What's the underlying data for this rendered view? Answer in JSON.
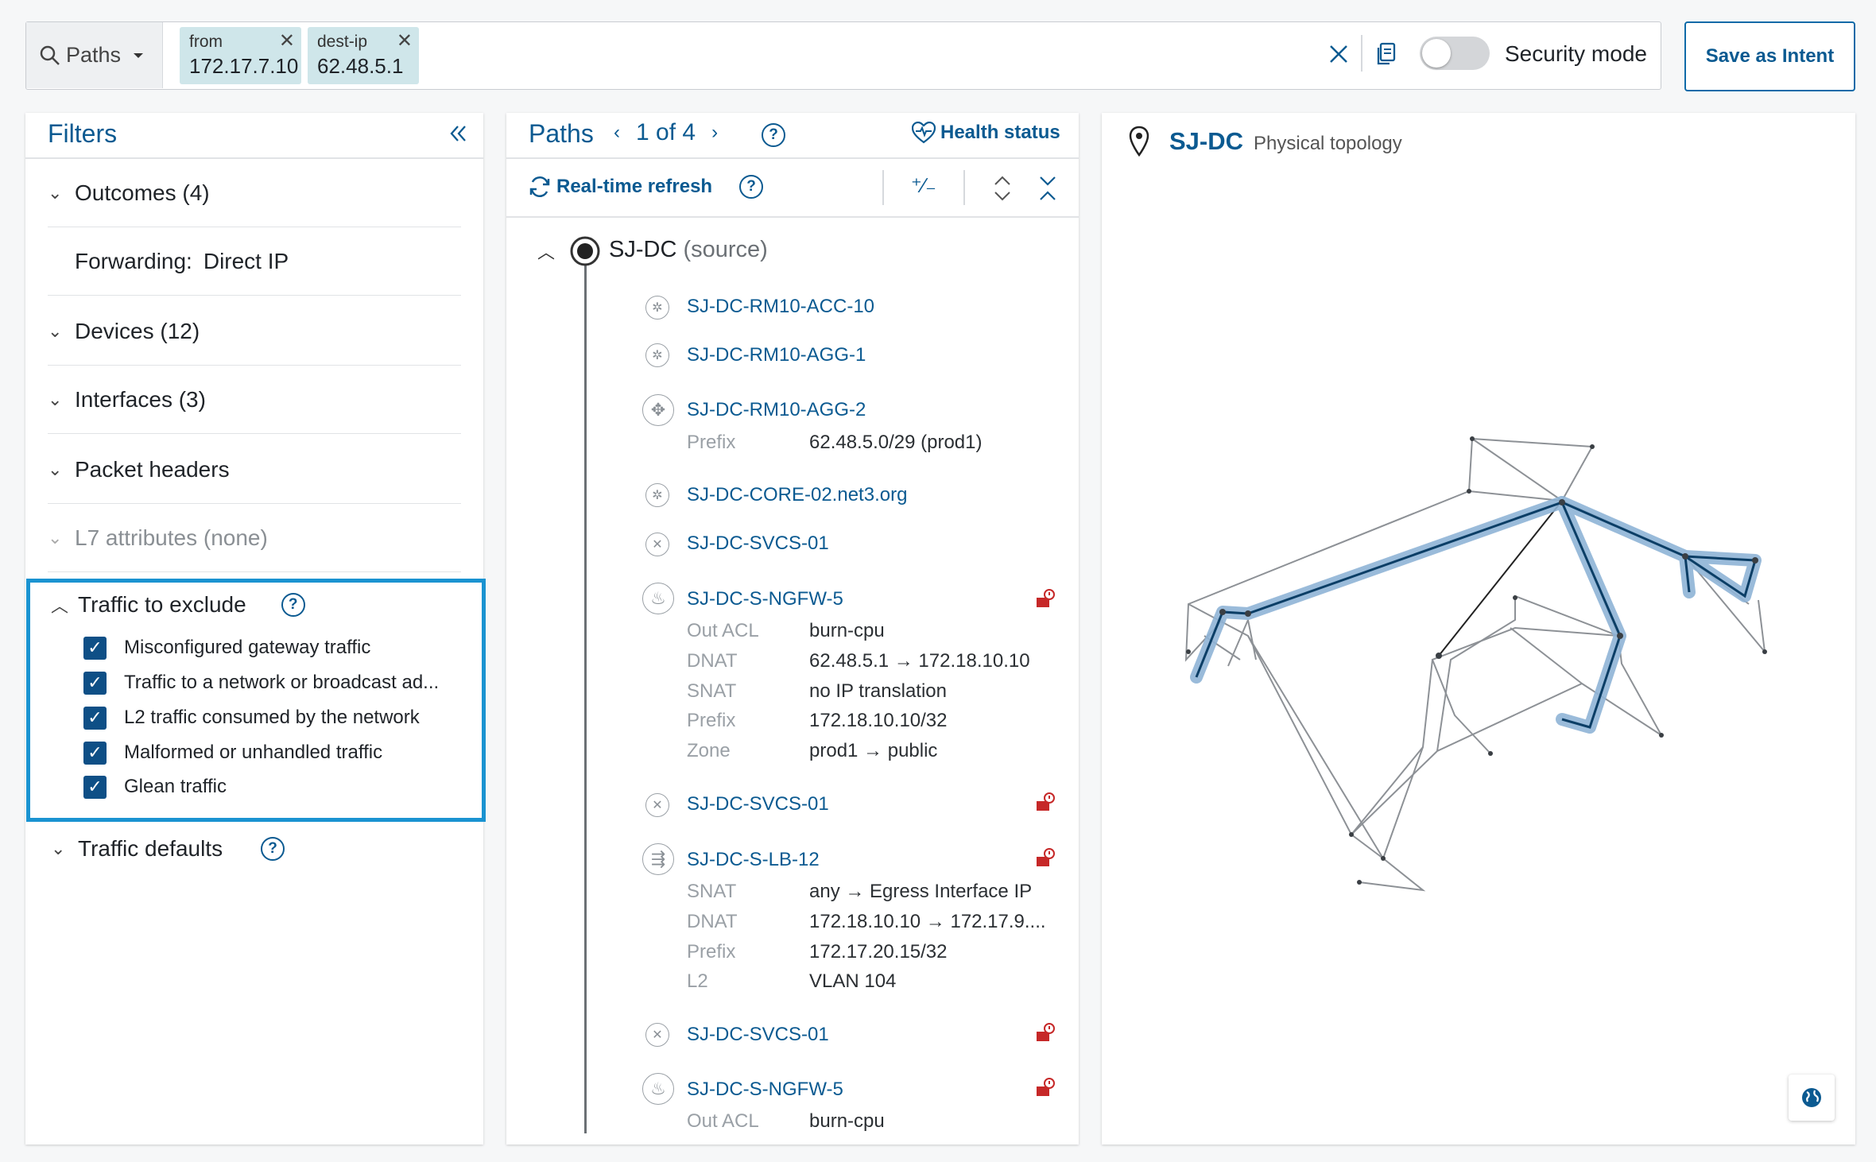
{
  "search": {
    "mode": "Paths",
    "chips": [
      {
        "key": "from",
        "value": "172.17.7.10"
      },
      {
        "key": "dest-ip",
        "value": "62.48.5.1"
      }
    ],
    "security_mode_label": "Security mode",
    "save_label": "Save as Intent"
  },
  "filters": {
    "title": "Filters",
    "sections": {
      "outcomes": "Outcomes (4)",
      "forwarding_key": "Forwarding:",
      "forwarding_value": "Direct IP",
      "devices": "Devices (12)",
      "interfaces": "Interfaces (3)",
      "packet_headers": "Packet headers",
      "l7": "L7 attributes (none)",
      "traffic_exclude": "Traffic to exclude",
      "traffic_defaults": "Traffic defaults"
    },
    "exclude_items": [
      "Misconfigured gateway traffic",
      "Traffic to a network or broadcast ad...",
      "L2 traffic consumed by the network",
      "Malformed or unhandled traffic",
      "Glean traffic"
    ]
  },
  "paths": {
    "title": "Paths",
    "pager": "1 of 4",
    "health_label": "Health status",
    "refresh_label": "Real-time refresh",
    "source_name": "SJ-DC",
    "source_suffix": "(source)",
    "hops": [
      {
        "name": "SJ-DC-RM10-ACC-10"
      },
      {
        "name": "SJ-DC-RM10-AGG-1"
      },
      {
        "name": "SJ-DC-RM10-AGG-2",
        "details": [
          [
            "Prefix",
            "62.48.5.0/29 (prod1)"
          ]
        ]
      },
      {
        "name": "SJ-DC-CORE-02.net3.org"
      },
      {
        "name": "SJ-DC-SVCS-01"
      },
      {
        "name": "SJ-DC-S-NGFW-5",
        "details": [
          [
            "Out ACL",
            "burn-cpu"
          ],
          [
            "DNAT",
            "62.48.5.1 → 172.18.10.10"
          ],
          [
            "SNAT",
            "no IP translation"
          ],
          [
            "Prefix",
            "172.18.10.10/32"
          ],
          [
            "Zone",
            "prod1 → public"
          ]
        ]
      },
      {
        "name": "SJ-DC-SVCS-01"
      },
      {
        "name": "SJ-DC-S-LB-12",
        "details": [
          [
            "SNAT",
            "any → Egress Interface IP"
          ],
          [
            "DNAT",
            "172.18.10.10 → 172.17.9...."
          ],
          [
            "Prefix",
            "172.17.20.15/32"
          ],
          [
            "L2",
            "VLAN 104"
          ]
        ]
      },
      {
        "name": "SJ-DC-SVCS-01"
      },
      {
        "name": "SJ-DC-S-NGFW-5",
        "details": [
          [
            "Out ACL",
            "burn-cpu"
          ]
        ]
      }
    ]
  },
  "topology": {
    "site": "SJ-DC",
    "subtitle": "Physical topology"
  },
  "icons": {
    "search": "search-icon",
    "clear": "close-icon",
    "copy": "copy-icon",
    "collapse": "double-chevron-left-icon",
    "heart": "health-icon",
    "refresh": "refresh-icon",
    "pin": "location-pin-icon",
    "globe": "globe-icon",
    "alert": "alert-icon"
  },
  "colors": {
    "accent": "#0b5a91",
    "highlight_border": "#1a93d1",
    "path_highlight": "#8fb4d6",
    "alert": "#c62828"
  }
}
